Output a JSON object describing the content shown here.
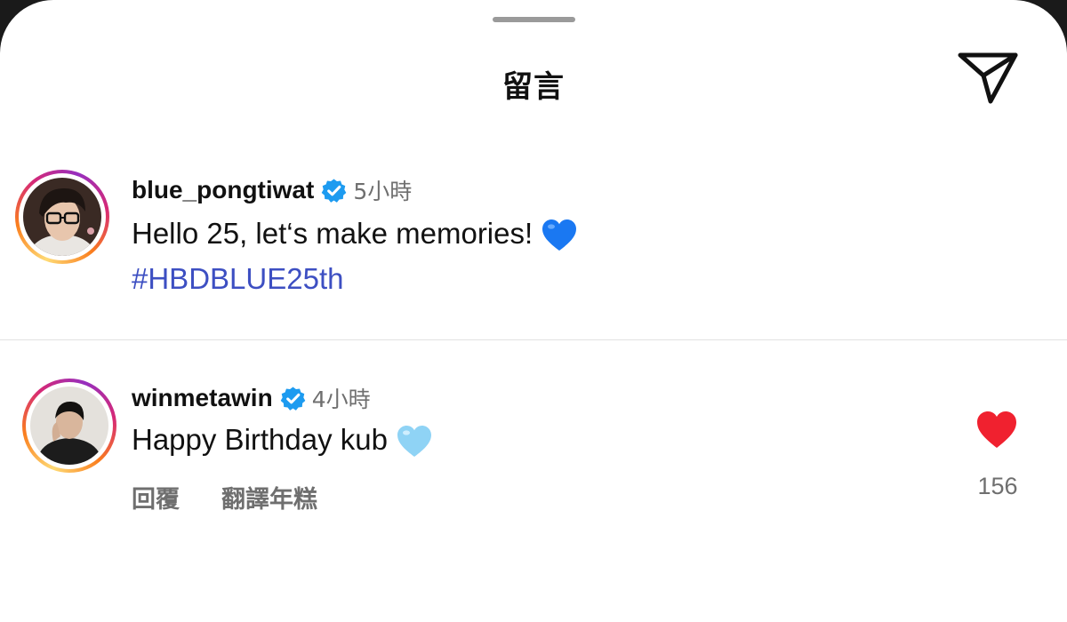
{
  "sheet": {
    "title": "留言",
    "send_icon": "paper-plane-icon"
  },
  "comments": [
    {
      "username": "blue_pongtiwat",
      "verified": true,
      "timestamp": "5小時",
      "text": "Hello 25, let‘s make memories!",
      "emoji": "blue-heart-emoji",
      "hashtag": "#HBDBLUE25th"
    },
    {
      "username": "winmetawin",
      "verified": true,
      "timestamp": "4小時",
      "text": "Happy Birthday kub",
      "emoji": "light-blue-heart-emoji",
      "reply_label": "回覆",
      "translate_label": "翻譯年糕",
      "like_count": "156",
      "liked": true
    }
  ],
  "colors": {
    "verified": "#1d9bf0",
    "hashtag": "#3d4fc2",
    "like": "#f0212f",
    "muted_text": "#6f6f6f",
    "blue_heart": "#1a78f2",
    "light_blue_heart": "#8fd3f5"
  }
}
